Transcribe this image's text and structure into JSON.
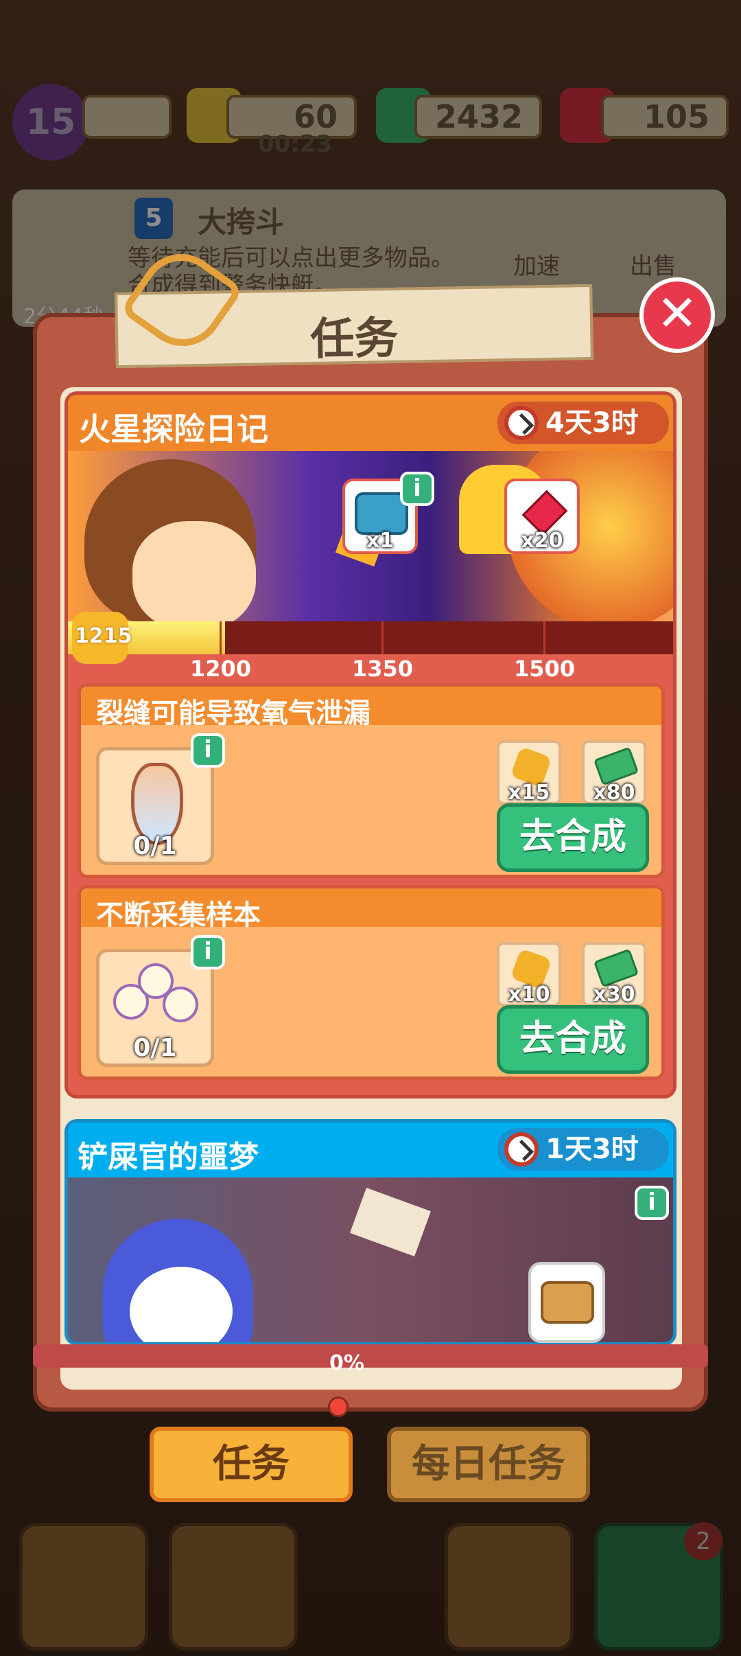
{
  "background": {
    "level": "15",
    "energy": "60",
    "energy_timer": "00:23",
    "cash": "2432",
    "gems": "105",
    "info_card": {
      "badge": "5",
      "title": "大挎斗",
      "desc": "等待充能后可以点出更多物品。",
      "desc2": "合成得到警务快艇。",
      "speed_label": "加速",
      "sell_label": "出售",
      "timer": "2分44秒"
    },
    "nav_badge": "2"
  },
  "modal": {
    "title": "任务",
    "close_icon": "close-icon"
  },
  "quest1": {
    "title": "火星探险日记",
    "time_left": "4天3时",
    "current_points": "1215",
    "progress": 0.26,
    "milestones": [
      "1200",
      "1350",
      "1500"
    ],
    "rewards": [
      {
        "icon": "treasure-chest-icon",
        "label": "x1"
      },
      {
        "icon": "ruby-gem-icon",
        "label": "x20"
      }
    ],
    "tasks": [
      {
        "title": "裂缝可能导致氧气泄漏",
        "item_icon": "vase-icon",
        "count": "0/1",
        "rewards": [
          {
            "icon": "star-icon",
            "label": "x15"
          },
          {
            "icon": "cash-icon",
            "label": "x80"
          }
        ],
        "button": "去合成"
      },
      {
        "title": "不断采集样本",
        "item_icon": "orb-lamp-icon",
        "count": "0/1",
        "rewards": [
          {
            "icon": "star-icon",
            "label": "x10"
          },
          {
            "icon": "cash-icon",
            "label": "x30"
          }
        ],
        "button": "去合成"
      }
    ]
  },
  "quest2": {
    "title": "铲屎官的噩梦",
    "time_left": "1天3时",
    "progress_text": "0%"
  },
  "tabs": {
    "active": "任务",
    "daily": "每日任务"
  },
  "colors": {
    "accent_orange": "#f0862a",
    "accent_blue": "#00aeef",
    "button_green": "#35c07c",
    "close_red": "#e8384b"
  }
}
